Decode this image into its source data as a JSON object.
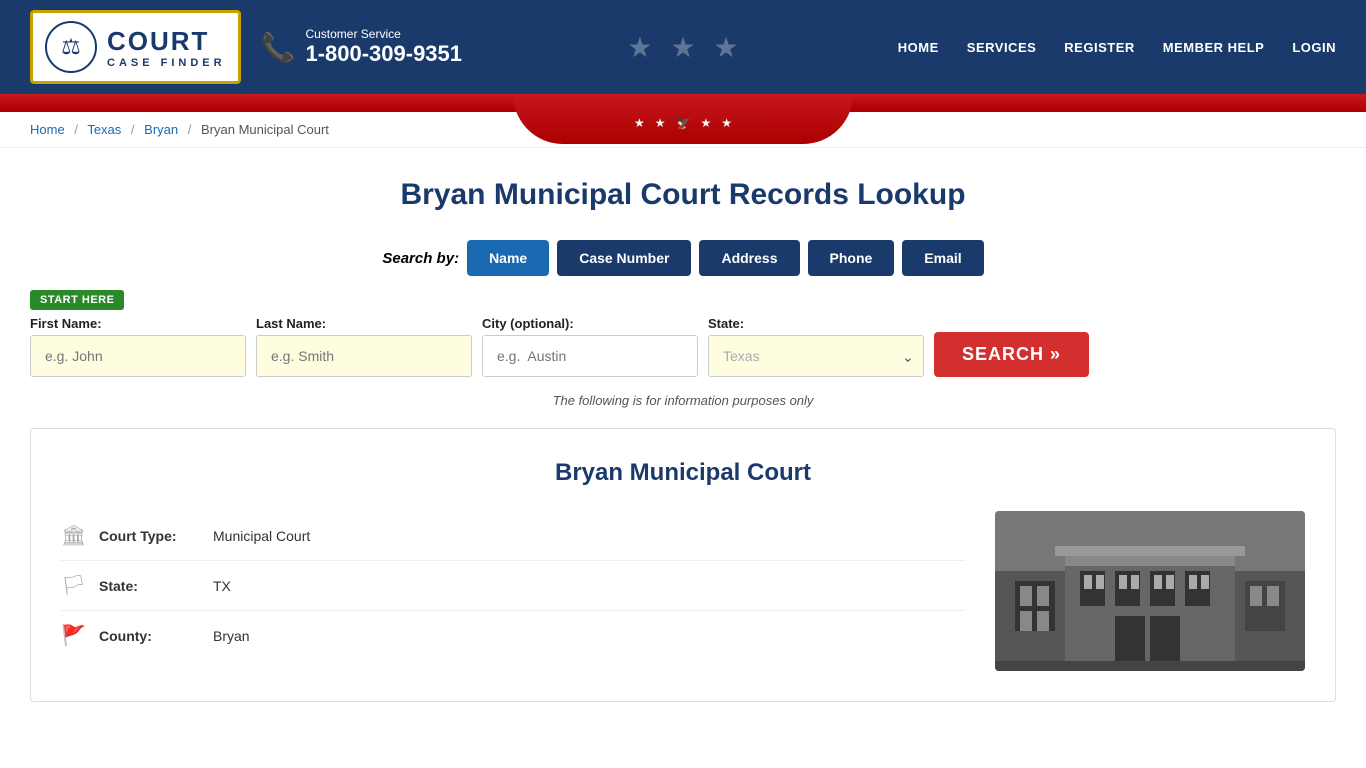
{
  "header": {
    "logo": {
      "court_text": "COURT",
      "case_finder_text": "CASE FINDER",
      "emblem_symbol": "⚖"
    },
    "phone": {
      "customer_service_label": "Customer Service",
      "number": "1-800-309-9351"
    },
    "nav": [
      {
        "label": "HOME",
        "id": "home"
      },
      {
        "label": "SERVICES",
        "id": "services"
      },
      {
        "label": "REGISTER",
        "id": "register"
      },
      {
        "label": "MEMBER HELP",
        "id": "member-help"
      },
      {
        "label": "LOGIN",
        "id": "login"
      }
    ]
  },
  "breadcrumb": {
    "items": [
      {
        "label": "Home",
        "link": true
      },
      {
        "label": "Texas",
        "link": true
      },
      {
        "label": "Bryan",
        "link": true
      },
      {
        "label": "Bryan Municipal Court",
        "link": false
      }
    ]
  },
  "page": {
    "title": "Bryan Municipal Court Records Lookup"
  },
  "search": {
    "by_label": "Search by:",
    "tabs": [
      {
        "label": "Name",
        "active": true
      },
      {
        "label": "Case Number",
        "active": false
      },
      {
        "label": "Address",
        "active": false
      },
      {
        "label": "Phone",
        "active": false
      },
      {
        "label": "Email",
        "active": false
      }
    ],
    "start_here_label": "START HERE",
    "fields": {
      "first_name_label": "First Name:",
      "first_name_placeholder": "e.g. John",
      "last_name_label": "Last Name:",
      "last_name_placeholder": "e.g. Smith",
      "city_label": "City (optional):",
      "city_placeholder": "e.g.  Austin",
      "state_label": "State:",
      "state_value": "Texas"
    },
    "button_label": "SEARCH »",
    "info_note": "The following is for information purposes only"
  },
  "court": {
    "title": "Bryan Municipal Court",
    "details": [
      {
        "icon": "🏛",
        "label": "Court Type:",
        "value": "Municipal Court"
      },
      {
        "icon": "🏳",
        "label": "State:",
        "value": "TX"
      },
      {
        "icon": "🚩",
        "label": "County:",
        "value": "Bryan"
      }
    ]
  }
}
